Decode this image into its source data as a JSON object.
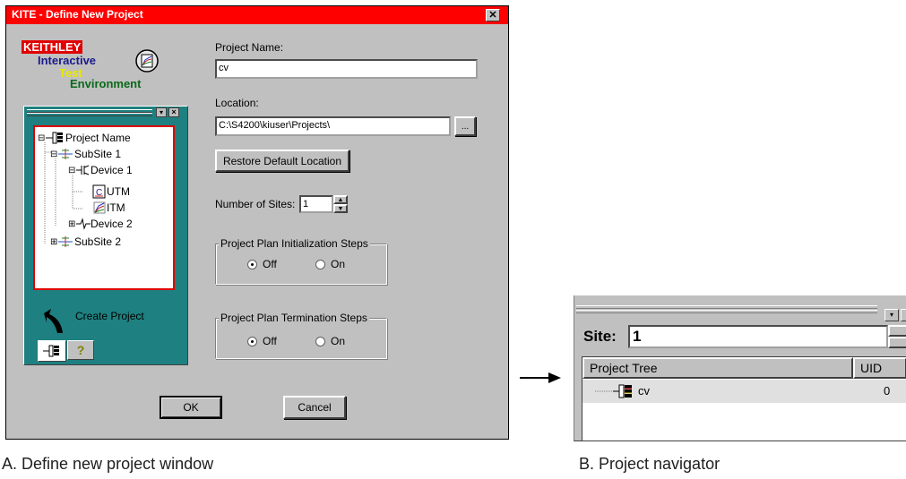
{
  "dialog": {
    "title": "KITE - Define New Project",
    "close_symbol": "✕",
    "logo": {
      "keithley": "KEITHLEY",
      "interactive": "Interactive",
      "test": "Test",
      "environment": "Environment"
    },
    "project_name_label": "Project Name:",
    "project_name_value": "cv",
    "location_label": "Location:",
    "location_value": "C:\\S4200\\kiuser\\Projects\\",
    "browse_label": "...",
    "restore_label": "Restore Default Location",
    "num_sites_label": "Number of Sites:",
    "num_sites_value": "1",
    "init_group": {
      "title": "Project Plan Initialization Steps",
      "off": "Off",
      "on": "On",
      "selected": "Off"
    },
    "term_group": {
      "title": "Project Plan Termination Steps",
      "off": "Off",
      "on": "On",
      "selected": "Off"
    },
    "ok_label": "OK",
    "cancel_label": "Cancel",
    "tree": {
      "items": [
        {
          "label": "Project Name",
          "icon": "project-icon"
        },
        {
          "label": "SubSite 1",
          "icon": "subsite-icon"
        },
        {
          "label": "Device 1",
          "icon": "device-icon"
        },
        {
          "label": "UTM",
          "icon": "utm-icon"
        },
        {
          "label": "ITM",
          "icon": "itm-icon"
        },
        {
          "label": "Device 2",
          "icon": "device-icon"
        },
        {
          "label": "SubSite 2",
          "icon": "subsite-icon"
        }
      ]
    },
    "create_project_label": "Create Project",
    "help_tab_symbol": "?"
  },
  "navigator": {
    "site_label": "Site:",
    "site_value": "1",
    "col_tree": "Project Tree",
    "col_uid": "UID",
    "row_label": "cv",
    "row_uid": "0"
  },
  "captions": {
    "a": "A. Define new project window",
    "b": "B. Project navigator"
  },
  "colors": {
    "title_bar": "#ff0000",
    "panel": "#1e8080",
    "tree_border": "#e00000",
    "window": "#c0c0c0"
  }
}
